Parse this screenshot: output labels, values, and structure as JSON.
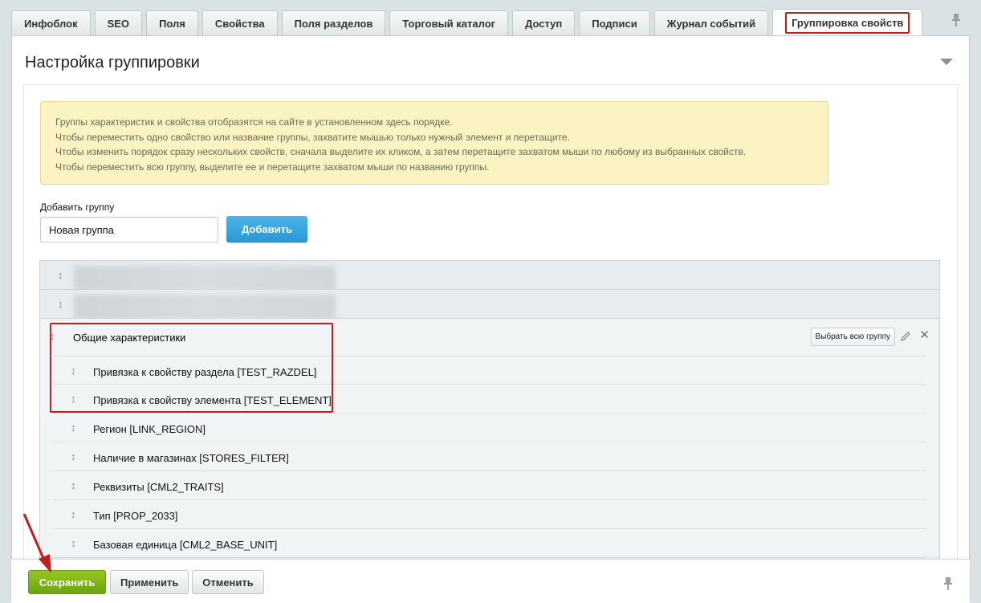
{
  "tabs": [
    {
      "label": "Инфоблок"
    },
    {
      "label": "SEO"
    },
    {
      "label": "Поля"
    },
    {
      "label": "Свойства"
    },
    {
      "label": "Поля разделов"
    },
    {
      "label": "Торговый каталог"
    },
    {
      "label": "Доступ"
    },
    {
      "label": "Подписи"
    },
    {
      "label": "Журнал событий"
    },
    {
      "label": "Группировка свойств",
      "active": true
    }
  ],
  "panel": {
    "title": "Настройка группировки"
  },
  "notice": {
    "lines": [
      "Группы характеристик и свойства отобразятся на сайте в установленном здесь порядке.",
      "Чтобы переместить одно свойство или название группы, захватите мышью только нужный элемент и перетащите.",
      "Чтобы изменить порядок сразу нескольких свойств, сначала выделите их кликом, а затем перетащите захватом мыши по любому из выбранных свойств.",
      "Чтобы переместить всю группу, выделите ее и перетащите захватом мыши по названию группы."
    ]
  },
  "add_group": {
    "label": "Добавить группу",
    "input_value": "Новая группа",
    "button_label": "Добавить"
  },
  "groups": {
    "handle_glyph": "↕",
    "open_group": {
      "name": "Общие характеристики",
      "select_all_label": "Выбрать всю группу",
      "delete_glyph": "✕",
      "properties": [
        {
          "label": "Привязка к свойству раздела [TEST_RAZDEL]"
        },
        {
          "label": "Привязка к свойству элемента [TEST_ELEMENT]"
        },
        {
          "label": "Регион [LINK_REGION]"
        },
        {
          "label": "Наличие в магазинах [STORES_FILTER]"
        },
        {
          "label": "Реквизиты [CML2_TRAITS]"
        },
        {
          "label": "Тип [PROP_2033]"
        },
        {
          "label": "Базовая единица [CML2_BASE_UNIT]"
        }
      ]
    }
  },
  "footer": {
    "save_label": "Сохранить",
    "apply_label": "Применить",
    "cancel_label": "Отменить"
  },
  "colors": {
    "highlight": "#c41d1d",
    "primary_button": "#2b97d3",
    "save_button": "#7ab317",
    "notice_bg": "#fbf3c2"
  }
}
